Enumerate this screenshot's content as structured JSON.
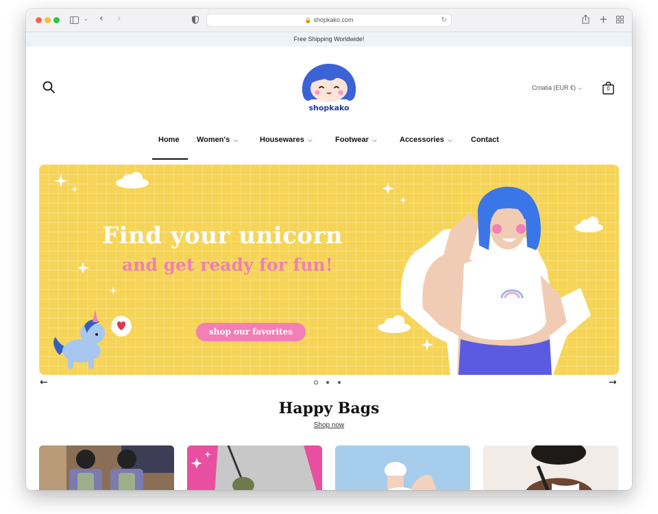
{
  "browser": {
    "url": "shopkako.com"
  },
  "announcement": "Free Shipping Worldwide!",
  "header": {
    "logo_text": "shopkako",
    "locale": "Croatia (EUR €)",
    "cart_count": "0"
  },
  "nav": [
    {
      "label": "Home",
      "active": true
    },
    {
      "label": "Women's",
      "dropdown": true
    },
    {
      "label": "Housewares",
      "dropdown": true
    },
    {
      "label": "Footwear",
      "dropdown": true
    },
    {
      "label": "Accessories",
      "dropdown": true
    },
    {
      "label": "Contact"
    }
  ],
  "hero": {
    "title": "Find your unicorn",
    "subtitle": "and get ready for fun!",
    "cta": "shop our favorites",
    "slides": 3,
    "active_slide": 1
  },
  "section": {
    "title": "Happy Bags",
    "link": "Shop now"
  },
  "colors": {
    "hero_bg": "#f6d457",
    "accent_pink": "#f27fb5",
    "announcement_bg": "#eef3f8",
    "logo_blue": "#3b63d6"
  },
  "icons": {
    "search": "search-icon",
    "cart": "shopping-bag-icon",
    "prev": "arrow-left-icon",
    "next": "arrow-right-icon"
  }
}
